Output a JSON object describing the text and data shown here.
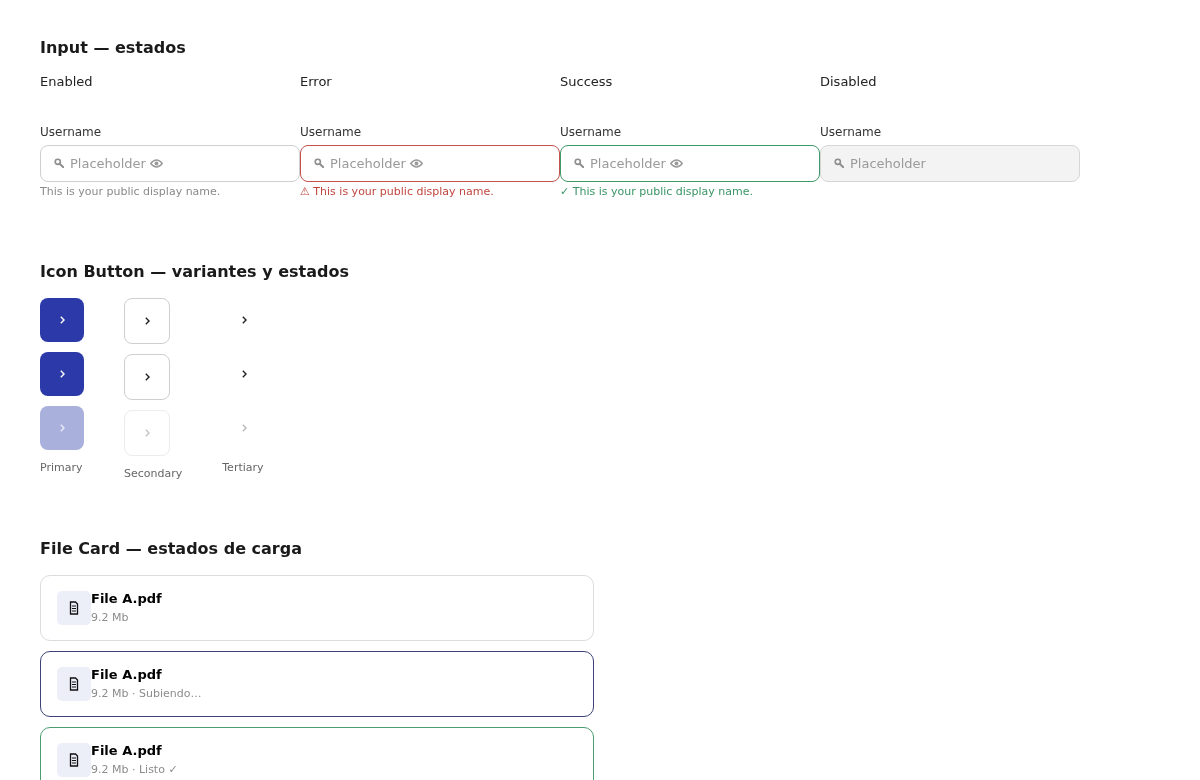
{
  "input_section": {
    "title": "Input — estados",
    "states": [
      {
        "kind": "enabled",
        "heading": "Enabled",
        "label": "Username",
        "placeholder": "Placeholder",
        "helper": "This is your public display name.",
        "disabled": false
      },
      {
        "kind": "error",
        "heading": "Error",
        "label": "Username",
        "placeholder": "Placeholder",
        "helper": "⚠ This is your public display name.",
        "disabled": false
      },
      {
        "kind": "success",
        "heading": "Success",
        "label": "Username",
        "placeholder": "Placeholder",
        "helper": "✓ This is your public display name.",
        "disabled": false
      },
      {
        "kind": "disabled",
        "heading": "Disabled",
        "label": "Username",
        "placeholder": "Placeholder",
        "disabled": true
      }
    ]
  },
  "icon_button_section": {
    "title": "Icon Button — variantes y estados",
    "variants": [
      {
        "kind": "primary",
        "label": "Primary",
        "buttons": [
          {
            "disabled": false
          },
          {
            "disabled": false
          },
          {
            "disabled": true
          }
        ]
      },
      {
        "kind": "secondary",
        "label": "Secondary",
        "buttons": [
          {
            "disabled": false
          },
          {
            "disabled": false
          },
          {
            "disabled": true
          }
        ]
      },
      {
        "kind": "tertiary",
        "label": "Tertiary",
        "buttons": [
          {
            "disabled": false
          },
          {
            "disabled": false
          },
          {
            "disabled": true
          }
        ]
      }
    ]
  },
  "file_card_section": {
    "title": "File Card — estados de carga",
    "cards": [
      {
        "kind": "idle",
        "name": "File A.pdf",
        "meta": "9.2 Mb"
      },
      {
        "kind": "uploading",
        "name": "File A.pdf",
        "meta": "9.2 Mb · Subiendo…"
      },
      {
        "kind": "done",
        "name": "File A.pdf",
        "meta": "9.2 Mb · Listo ✓"
      }
    ]
  }
}
